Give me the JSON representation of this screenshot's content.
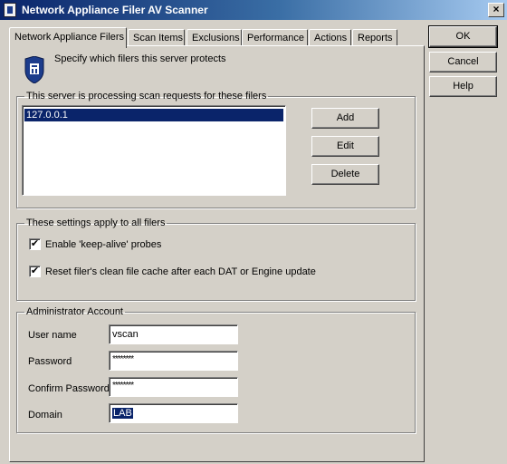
{
  "window": {
    "title": "Network Appliance Filer AV Scanner",
    "close_glyph": "×"
  },
  "tabs": [
    {
      "label": "Network Appliance Filers",
      "active": true
    },
    {
      "label": "Scan Items"
    },
    {
      "label": "Exclusions"
    },
    {
      "label": "Performance"
    },
    {
      "label": "Actions"
    },
    {
      "label": "Reports"
    }
  ],
  "dialog_buttons": {
    "ok": "OK",
    "cancel": "Cancel",
    "help": "Help"
  },
  "intro": {
    "icon": "server-protect-icon",
    "text": "Specify which filers this server protects"
  },
  "filers_group": {
    "legend": "This server is processing scan requests for these filers",
    "items": [
      "127.0.0.1"
    ],
    "add": "Add",
    "edit": "Edit",
    "delete": "Delete"
  },
  "settings_group": {
    "legend": "These settings apply to all filers",
    "keepalive": {
      "label": "Enable 'keep-alive' probes",
      "checked": true
    },
    "reset_cache": {
      "label": "Reset filer's clean file cache after each DAT or Engine update",
      "checked": true
    },
    "check_glyph": "✔"
  },
  "admin_group": {
    "legend": "Administrator Account",
    "username_label": "User name",
    "username_value": "vscan",
    "password_label": "Password",
    "password_mask": "********",
    "confirm_label": "Confirm Password",
    "confirm_mask": "********",
    "domain_label": "Domain",
    "domain_value": "LAB"
  },
  "colors": {
    "titlebar": "#0a246a",
    "selection": "#0a246a",
    "face": "#d4d0c8"
  }
}
